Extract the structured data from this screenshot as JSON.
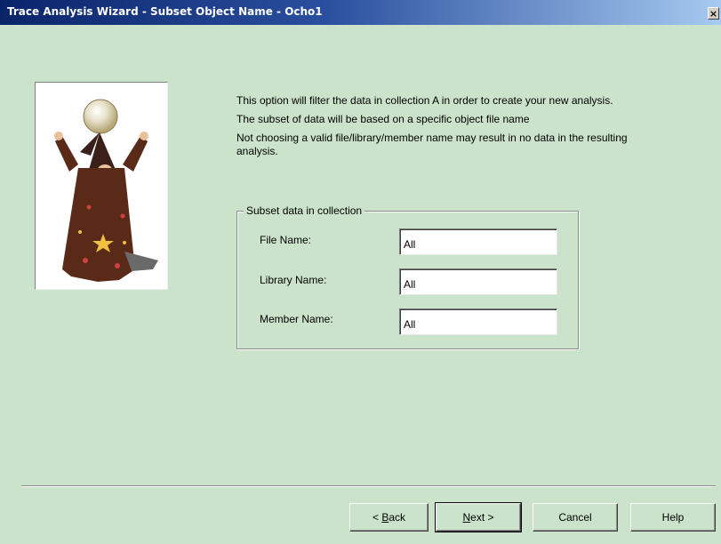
{
  "window": {
    "title": "Trace Analysis Wizard - Subset Object Name - Ocho1",
    "close_label": "×"
  },
  "intro": {
    "line1": "This option will filter the data in collection A in order to create your new analysis.",
    "line2": "The subset of data will be based on a specific object file name",
    "line3": "Not choosing a valid file/library/member name may result in no data in the resulting analysis."
  },
  "group": {
    "legend": "Subset data in collection",
    "fields": [
      {
        "label": "File Name:",
        "value": "All"
      },
      {
        "label": "Library Name:",
        "value": "All"
      },
      {
        "label": "Member Name:",
        "value": "All"
      }
    ]
  },
  "buttons": {
    "back_prefix": "< ",
    "back_accel": "B",
    "back_rest": "ack",
    "next_accel": "N",
    "next_rest": "ext >",
    "cancel": "Cancel",
    "help": "Help"
  },
  "colors": {
    "background": "#cbe3cb",
    "titlebar_start": "#0a246a",
    "titlebar_end": "#a6caf0"
  },
  "icons": [
    "wizard-illustration",
    "close-icon"
  ]
}
